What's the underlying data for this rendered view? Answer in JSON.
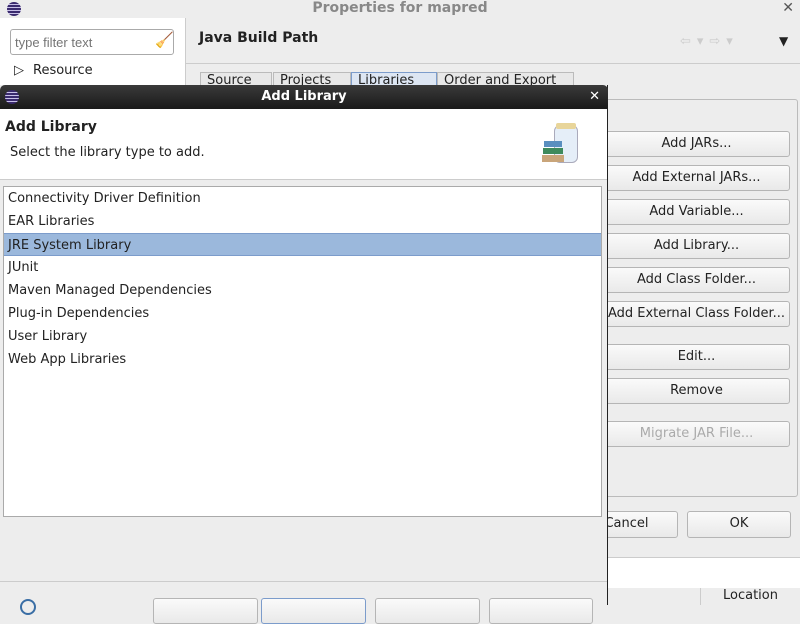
{
  "window": {
    "title": "Properties for mapred"
  },
  "sidebar": {
    "filter_placeholder": "type filter text",
    "items": [
      {
        "label": "Resource"
      }
    ]
  },
  "page": {
    "title": "Java Build Path",
    "tabs": [
      "Source",
      "Projects",
      "Libraries",
      "Order and Export"
    ]
  },
  "buttons": [
    "Add JARs...",
    "Add External JARs...",
    "Add Variable...",
    "Add Library...",
    "Add Class Folder...",
    "Add External Class Folder...",
    "Edit...",
    "Remove",
    "Migrate JAR File..."
  ],
  "footer": {
    "cancel": "Cancel",
    "ok": "OK",
    "column_location": "Location"
  },
  "dialog": {
    "title": "Add Library",
    "heading": "Add Library",
    "description": "Select the library type to add.",
    "items": [
      "Connectivity Driver Definition",
      "EAR Libraries",
      "JRE System Library",
      "JUnit",
      "Maven Managed Dependencies",
      "Plug-in Dependencies",
      "User Library",
      "Web App Libraries"
    ],
    "selected_index": 2
  }
}
